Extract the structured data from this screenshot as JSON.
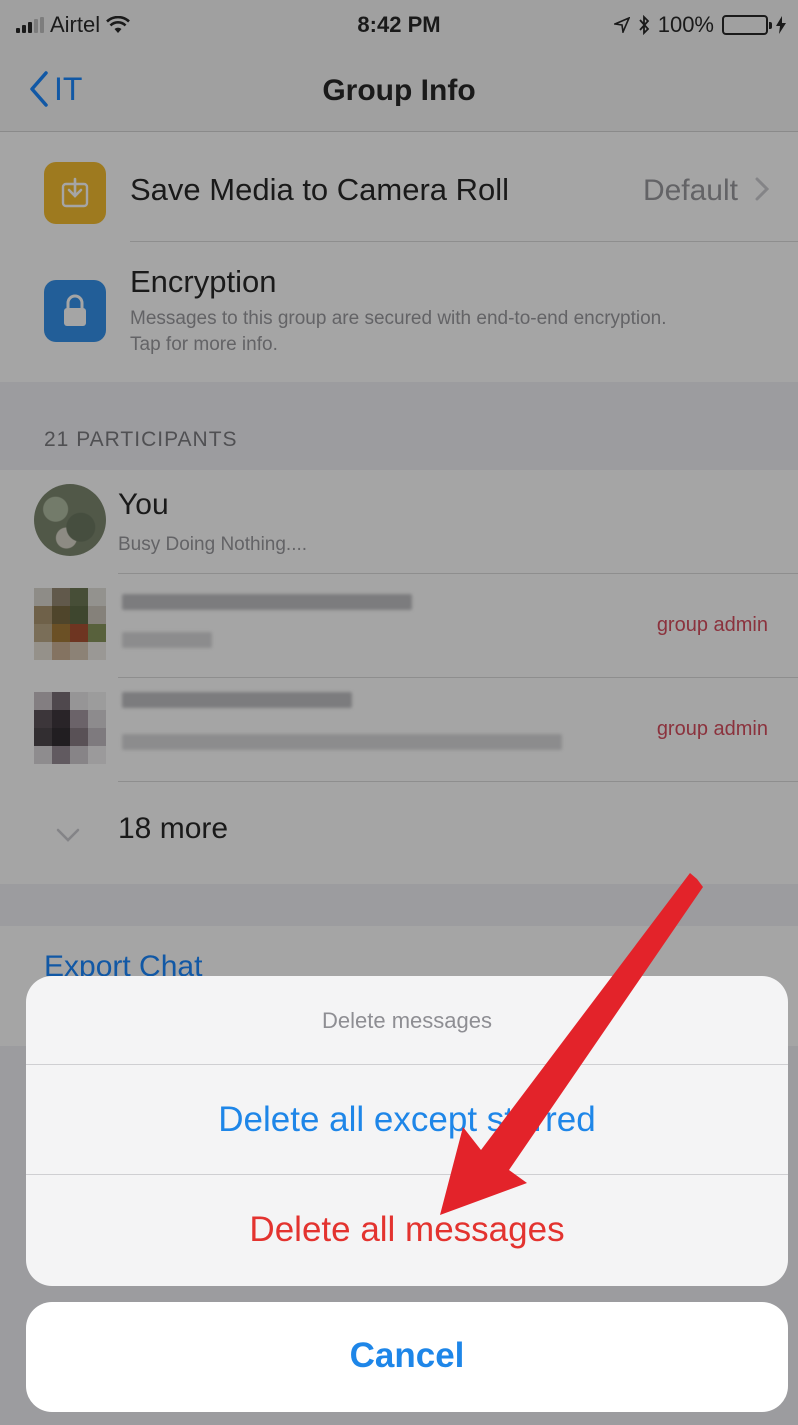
{
  "status_bar": {
    "carrier": "Airtel",
    "time": "8:42 PM",
    "battery": "100%",
    "icons": [
      "signal-icon",
      "wifi-icon",
      "location-icon",
      "bluetooth-icon",
      "battery-icon"
    ]
  },
  "nav": {
    "back_label": "IT",
    "title": "Group Info"
  },
  "settings": {
    "save_media": {
      "label": "Save Media to Camera Roll",
      "value": "Default",
      "icon": "save-icon"
    },
    "encryption": {
      "label": "Encryption",
      "description": "Messages to this group are secured with end-to-end encryption. Tap for more info.",
      "icon": "lock-icon"
    }
  },
  "participants": {
    "header": "21 PARTICIPANTS",
    "you": {
      "name": "You",
      "status": "Busy Doing Nothing...."
    },
    "admin_badge": "group admin",
    "more_label": "18 more"
  },
  "actions": {
    "export_label": "Export Chat"
  },
  "action_sheet": {
    "title": "Delete messages",
    "delete_except_starred": "Delete all except starred",
    "delete_all": "Delete all messages",
    "cancel": "Cancel"
  },
  "colors": {
    "ios_blue": "#1e86e8",
    "destructive_red": "#e3332f",
    "admin_red": "#d23a4c",
    "annotation_arrow": "#e3232a"
  }
}
